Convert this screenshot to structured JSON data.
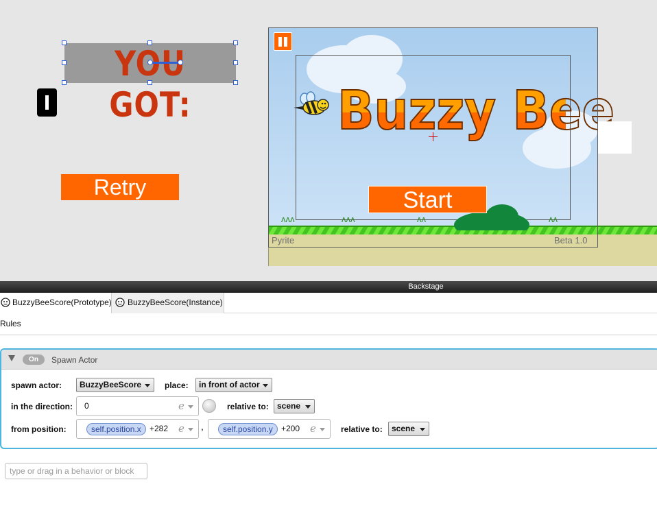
{
  "scene": {
    "you_got_text": "YOU GOT:",
    "retry_label": "Retry",
    "game_title": "Buzzy Bee",
    "start_label": "Start",
    "footer_left": "Pyrite",
    "footer_right": "Beta 1.0"
  },
  "backstage": {
    "title": "Backstage",
    "tabs": [
      {
        "label": "BuzzyBeeScore(Prototype)",
        "icon": "mask-icon"
      },
      {
        "label": "BuzzyBeeScore(Instance)",
        "icon": "mask-icon"
      }
    ],
    "rules_label": "Rules",
    "behavior": {
      "toggle_label": "On",
      "title": "Spawn Actor",
      "spawn_actor_label": "spawn actor:",
      "spawn_actor_value": "BuzzyBeeScore",
      "place_label": "place:",
      "place_value": "in front of actor",
      "direction_label": "in the direction:",
      "direction_value": "0",
      "relative_to_label": "relative to:",
      "direction_relative_value": "scene",
      "from_position_label": "from position:",
      "x_token": "self.position.x",
      "x_suffix": "+282",
      "comma": ",",
      "y_token": "self.position.y",
      "y_suffix": "+200",
      "position_relative_value": "scene",
      "expression_icon": "e"
    },
    "search_placeholder": "type or drag in a behavior or block"
  },
  "colors": {
    "accent_orange": "#ff6600",
    "selection_blue": "#2e5fd6",
    "behavior_border": "#4fb4de"
  }
}
